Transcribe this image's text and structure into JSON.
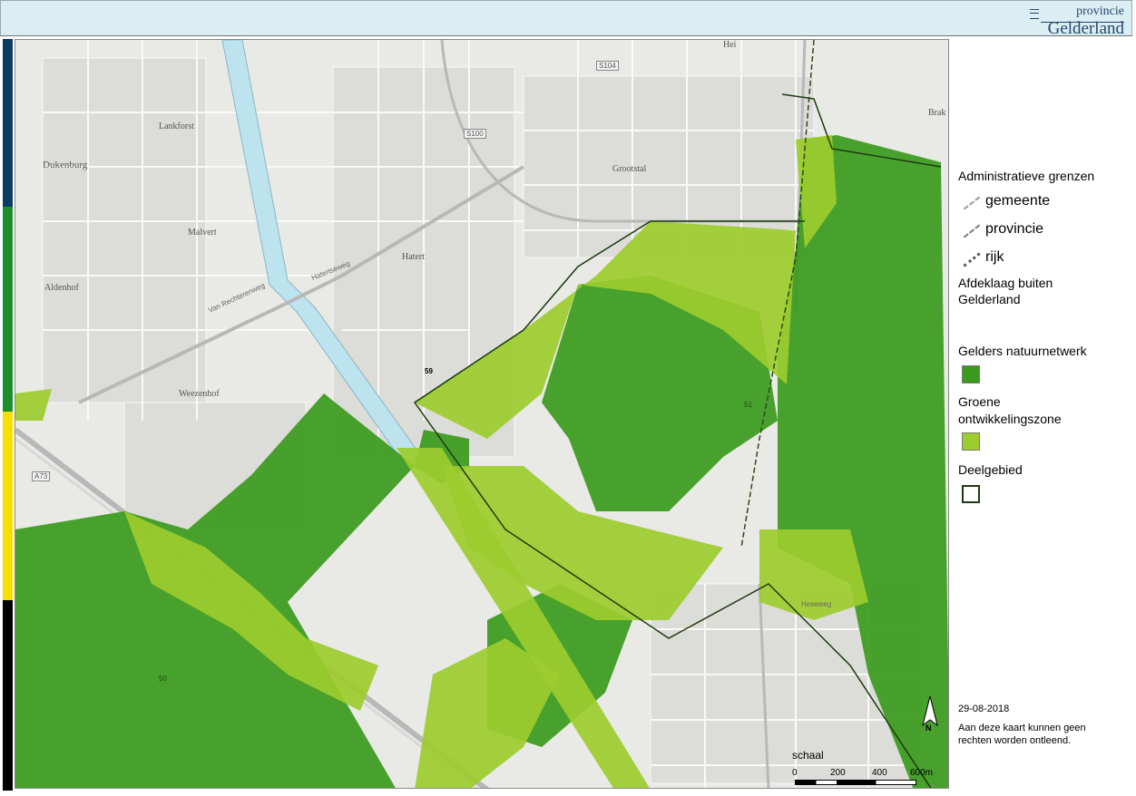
{
  "header": {
    "logo_top": "provincie",
    "logo_bottom": "Gelderland"
  },
  "colors": {
    "natuurnetwerk": "#3a9a1c",
    "ontwikkelingszone": "#9ccc2e",
    "map_base": "#e8e8e4",
    "water": "#bde3ee",
    "side_bar": [
      "#0b3b62",
      "#1d8f2a",
      "#f5e000",
      "#000000"
    ]
  },
  "map": {
    "places": [
      "Hei",
      "Lankforst",
      "Dukenburg",
      "Malvert",
      "Aldenhof",
      "Hatert",
      "Weezenhof",
      "Grootstal",
      "Brak"
    ],
    "roads": [
      "S104",
      "S100",
      "A73",
      "Hatertseweg",
      "Van Rechterenweg",
      "Heseweg"
    ],
    "area_labels": [
      "59",
      "51",
      "50"
    ],
    "north": "N",
    "scale_title": "schaal",
    "scale_ticks": [
      "0",
      "200",
      "400",
      "600m"
    ]
  },
  "legend": {
    "admin_title": "Administratieve grenzen",
    "lines": [
      {
        "label": "gemeente",
        "icon": "gemeente-line-icon"
      },
      {
        "label": "provincie",
        "icon": "provincie-line-icon"
      },
      {
        "label": "rijk",
        "icon": "rijk-line-icon"
      }
    ],
    "afdeklaag_1": "Afdeklaag buiten",
    "afdeklaag_2": "Gelderland",
    "natuurnetwerk": "Gelders natuurnetwerk",
    "groene_1": "Groene",
    "groene_2": "ontwikkelingszone",
    "deelgebied": "Deelgebied",
    "date": "29-08-2018",
    "disclaimer_1": "Aan deze kaart kunnen geen",
    "disclaimer_2": "rechten worden ontleend."
  }
}
